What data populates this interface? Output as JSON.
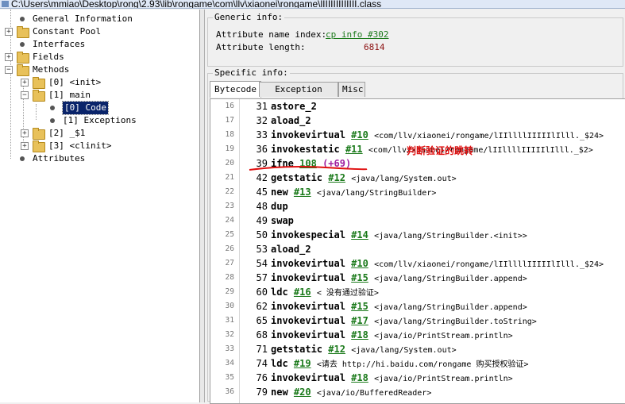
{
  "window": {
    "title": "C:\\Users\\mmiao\\Desktop\\rong\\2.93\\lib\\rongame\\com\\llv\\xiaonei\\rongame\\lIIIIIIIIIIIII.class"
  },
  "tree": {
    "general_info": "General Information",
    "constant_pool": "Constant Pool",
    "interfaces": "Interfaces",
    "fields": "Fields",
    "methods": "Methods",
    "m0": "[0] <init>",
    "m1": "[1] main",
    "m1_code": "[0] Code",
    "m1_exceptions": "[1] Exceptions",
    "m2": "[2] _$1",
    "m3": "[3] <clinit>",
    "attributes": "Attributes"
  },
  "generic": {
    "title": "Generic info:",
    "name_index_label": "Attribute name index:",
    "name_index_value": "cp info #302",
    "length_label": "Attribute length:",
    "length_value": "6814"
  },
  "specific": {
    "title": "Specific info:"
  },
  "tabs": [
    "Bytecode",
    "Exception table",
    "Misc"
  ],
  "annotation": "判断验证的跳转",
  "bytecode": [
    {
      "line": "16",
      "offset": "31",
      "op": "astore_2",
      "arg": "",
      "ref": ""
    },
    {
      "line": "17",
      "offset": "32",
      "op": "aload_2",
      "arg": "",
      "ref": ""
    },
    {
      "line": "18",
      "offset": "33",
      "op": "invokevirtual",
      "arg": "#10",
      "ref": "<com/llv/xiaonei/rongame/lIIllllIIIIIlIlll._$24>"
    },
    {
      "line": "19",
      "offset": "36",
      "op": "invokestatic",
      "arg": "#11",
      "ref": "<com/llv/xiaonei/rongame/lIIllllIIIIIlIlll._$2>"
    },
    {
      "line": "20",
      "offset": "39",
      "op": "ifne",
      "arg": "108",
      "ref": "",
      "jump": "(+69)"
    },
    {
      "line": "21",
      "offset": "42",
      "op": "getstatic",
      "arg": "#12",
      "ref": "<java/lang/System.out>"
    },
    {
      "line": "22",
      "offset": "45",
      "op": "new",
      "arg": "#13",
      "ref": "<java/lang/StringBuilder>"
    },
    {
      "line": "23",
      "offset": "48",
      "op": "dup",
      "arg": "",
      "ref": ""
    },
    {
      "line": "24",
      "offset": "49",
      "op": "swap",
      "arg": "",
      "ref": ""
    },
    {
      "line": "25",
      "offset": "50",
      "op": "invokespecial",
      "arg": "#14",
      "ref": "<java/lang/StringBuilder.<init>>"
    },
    {
      "line": "26",
      "offset": "53",
      "op": "aload_2",
      "arg": "",
      "ref": ""
    },
    {
      "line": "27",
      "offset": "54",
      "op": "invokevirtual",
      "arg": "#10",
      "ref": "<com/llv/xiaonei/rongame/lIIllllIIIIIlIlll._$24>"
    },
    {
      "line": "28",
      "offset": "57",
      "op": "invokevirtual",
      "arg": "#15",
      "ref": "<java/lang/StringBuilder.append>"
    },
    {
      "line": "29",
      "offset": "60",
      "op": "ldc",
      "arg": "#16",
      "ref": "< 没有通过验证>"
    },
    {
      "line": "30",
      "offset": "62",
      "op": "invokevirtual",
      "arg": "#15",
      "ref": "<java/lang/StringBuilder.append>"
    },
    {
      "line": "31",
      "offset": "65",
      "op": "invokevirtual",
      "arg": "#17",
      "ref": "<java/lang/StringBuilder.toString>"
    },
    {
      "line": "32",
      "offset": "68",
      "op": "invokevirtual",
      "arg": "#18",
      "ref": "<java/io/PrintStream.println>"
    },
    {
      "line": "33",
      "offset": "71",
      "op": "getstatic",
      "arg": "#12",
      "ref": "<java/lang/System.out>"
    },
    {
      "line": "34",
      "offset": "74",
      "op": "ldc",
      "arg": "#19",
      "ref": "<请去 http://hi.baidu.com/rongame 购买授权验证>"
    },
    {
      "line": "35",
      "offset": "76",
      "op": "invokevirtual",
      "arg": "#18",
      "ref": "<java/io/PrintStream.println>"
    },
    {
      "line": "36",
      "offset": "79",
      "op": "new",
      "arg": "#20",
      "ref": "<java/io/BufferedReader>"
    }
  ],
  "colors": {
    "link": "#1b7a1b",
    "jump": "#a020a0",
    "annotation": "#e01010",
    "selection": "#0a246a"
  }
}
